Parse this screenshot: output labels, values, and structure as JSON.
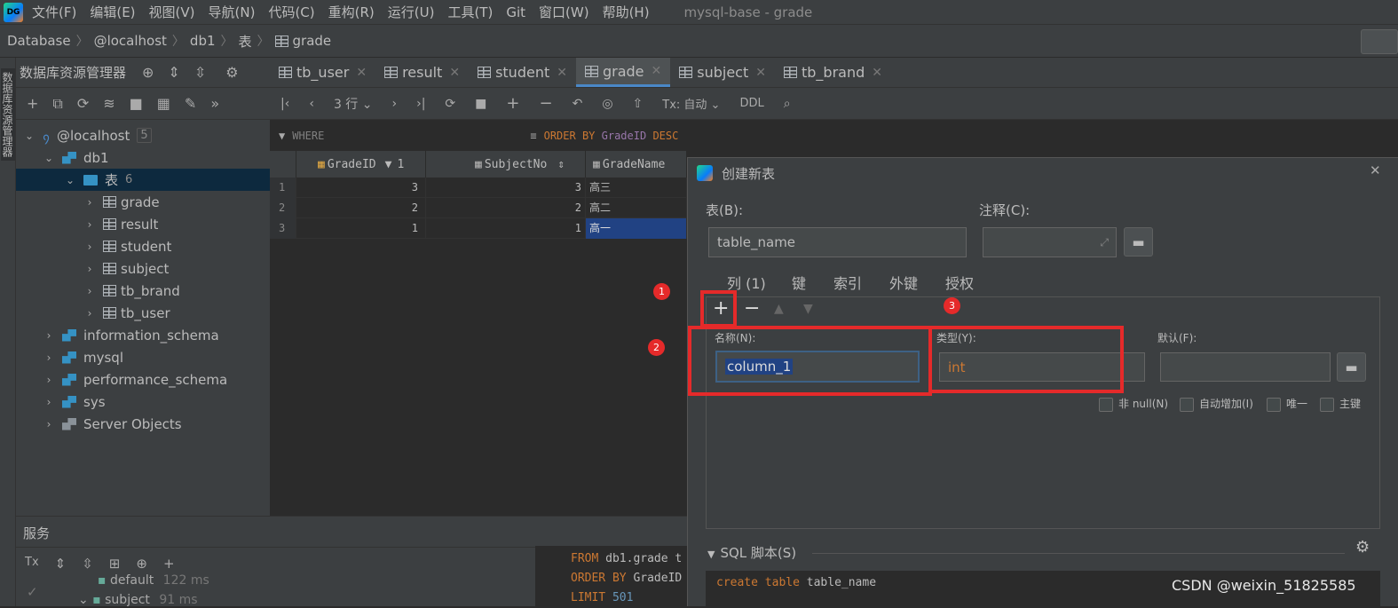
{
  "menubar": {
    "logo": "DG",
    "items": [
      "文件(F)",
      "编辑(E)",
      "视图(V)",
      "导航(N)",
      "代码(C)",
      "重构(R)",
      "运行(U)",
      "工具(T)",
      "Git",
      "窗口(W)",
      "帮助(H)"
    ],
    "window_title": "mysql-base - grade"
  },
  "breadcrumb": [
    "Database",
    "@localhost",
    "db1",
    "表",
    "grade"
  ],
  "left_strip": {
    "label": "数据库资源管理器"
  },
  "db_panel": {
    "title": "数据库资源管理器",
    "host": {
      "label": "@localhost",
      "count": "5"
    },
    "db1": "db1",
    "tables_folder": {
      "label": "表",
      "count": "6"
    },
    "tables": [
      "grade",
      "result",
      "student",
      "subject",
      "tb_brand",
      "tb_user"
    ],
    "schemas": [
      "information_schema",
      "mysql",
      "performance_schema",
      "sys",
      "Server Objects"
    ]
  },
  "tabs": [
    {
      "label": "tb_user",
      "active": false
    },
    {
      "label": "result",
      "active": false
    },
    {
      "label": "student",
      "active": false
    },
    {
      "label": "grade",
      "active": true
    },
    {
      "label": "subject",
      "active": false
    },
    {
      "label": "tb_brand",
      "active": false
    }
  ],
  "grid_toolbar": {
    "rows": "3 行",
    "tx": "Tx: 自动",
    "ddl": "DDL"
  },
  "filter": {
    "where": "WHERE",
    "order_kw": "ORDER BY",
    "order_col": "GradeID",
    "order_dir": "DESC"
  },
  "grid": {
    "columns": [
      {
        "name": "GradeID",
        "sort": "1"
      },
      {
        "name": "SubjectNo",
        "sort": ""
      },
      {
        "name": "GradeName",
        "sort": ""
      }
    ],
    "rows": [
      {
        "num": "1",
        "gradeid": "3",
        "subjectno": "3",
        "gradename": "高三"
      },
      {
        "num": "2",
        "gradeid": "2",
        "subjectno": "2",
        "gradename": "高二"
      },
      {
        "num": "3",
        "gradeid": "1",
        "subjectno": "1",
        "gradename": "高一"
      }
    ]
  },
  "services": {
    "title": "服务",
    "tx": "Tx",
    "item1": "default",
    "item1_time": "122 ms",
    "item2": "subject",
    "item2_time": "91 ms",
    "sql": [
      {
        "kw": "FROM",
        "rest": "db1.grade t"
      },
      {
        "kw": "ORDER BY",
        "rest": "GradeID"
      },
      {
        "kw": "LIMIT",
        "rest": "501"
      }
    ]
  },
  "dialog": {
    "title": "创建新表",
    "table_label": "表(B):",
    "table_value": "table_name",
    "comment_label": "注释(C):",
    "tabs": [
      "列 (1)",
      "键",
      "索引",
      "外键",
      "授权"
    ],
    "name_label": "名称(N):",
    "name_value": "column_1",
    "type_label": "类型(Y):",
    "type_value": "int",
    "default_label": "默认(F):",
    "checks": [
      "非 null(N)",
      "自动增加(I)",
      "唯一",
      "主键"
    ],
    "sql_title": "SQL 脚本(S)",
    "sql_line": {
      "kw1": "create",
      "kw2": "table",
      "name": "table_name"
    }
  },
  "annotations": [
    "1",
    "2",
    "3"
  ],
  "watermark": "CSDN @weixin_51825585",
  "colors": {
    "accent": "#4a88c7",
    "annotation_red": "#e52a2a",
    "keyword": "#cc7832",
    "number": "#6897bb"
  }
}
